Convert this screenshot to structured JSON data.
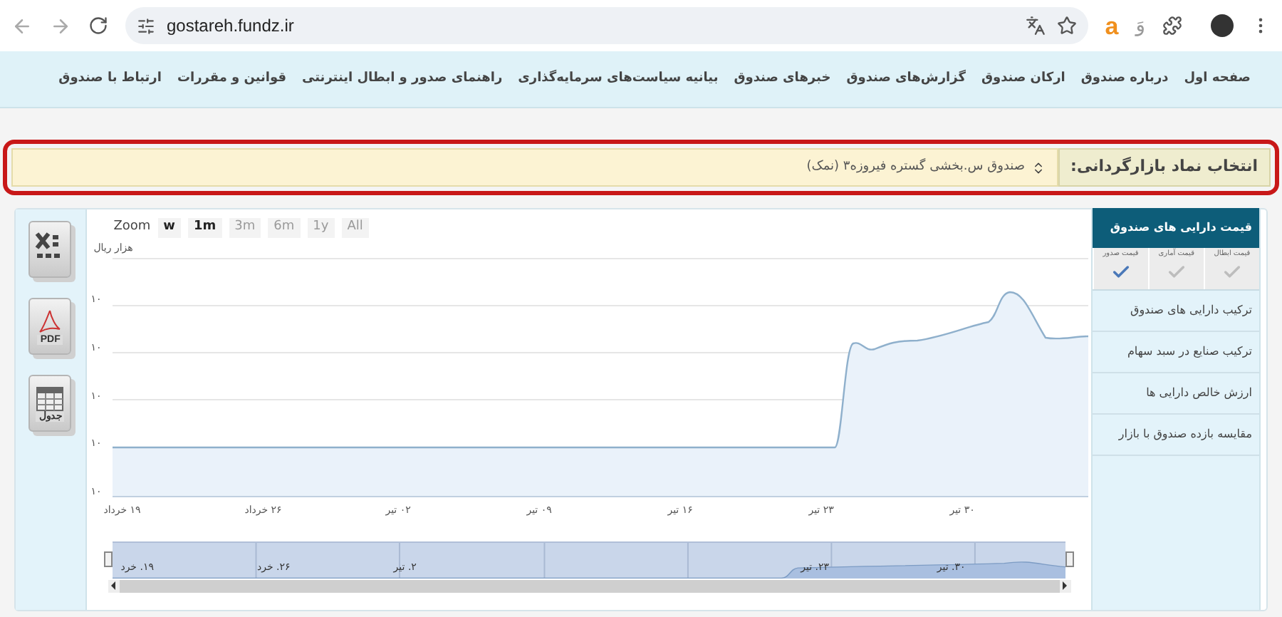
{
  "browser": {
    "url": "gostareh.fundz.ir",
    "extension_label": "a",
    "extension_label_2": "وَ"
  },
  "nav": {
    "items": [
      "صفحه اول",
      "درباره صندوق",
      "ارکان صندوق",
      "گزارش‌های صندوق",
      "خبرهای صندوق",
      "بیانیه سیاست‌های سرمایه‌گذاری",
      "راهنمای صدور و ابطال اینترنتی",
      "قوانین و مقررات",
      "ارتباط با صندوق"
    ]
  },
  "selector": {
    "label": "انتخاب نماد بازارگردانی:",
    "value": "صندوق س.بخشی گستره فیروزه۳ (نمک)"
  },
  "exports": [
    {
      "kind": "excel"
    },
    {
      "kind": "pdf",
      "label": "PDF"
    },
    {
      "kind": "table",
      "label": "جدول"
    }
  ],
  "chart": {
    "zoom_label": "Zoom",
    "zoom_buttons": [
      {
        "label": "All",
        "disabled": true
      },
      {
        "label": "1y",
        "disabled": true
      },
      {
        "label": "6m",
        "disabled": true
      },
      {
        "label": "3m",
        "disabled": true
      },
      {
        "label": "1m",
        "disabled": false
      },
      {
        "label": "w",
        "disabled": false
      }
    ],
    "ylabel": "هزار ریال",
    "yticks": [
      "۱۰",
      "۱۰",
      "۱۰",
      "۱۰",
      "۱۰"
    ],
    "xticks": [
      "۳۰ تیر",
      "۲۳ تیر",
      "۱۶ تیر",
      "۰۹ تیر",
      "۰۲ تیر",
      "۲۶ خرداد",
      "۱۹ خرداد"
    ],
    "navigator_labels": [
      "۳۰. تیر",
      "۲۳. تیر",
      "۲. تیر",
      "۲۶. خرد",
      "۱۹. خرد"
    ]
  },
  "sidebar": {
    "header": "قیمت دارایی های صندوق",
    "price_options": [
      {
        "label": "قیمت ابطال",
        "checked": false
      },
      {
        "label": "قیمت آماری",
        "checked": false
      },
      {
        "label": "قیمت صدور",
        "checked": true
      }
    ],
    "items": [
      "ترکیب دارایی های صندوق",
      "ترکیب صنایع در سبد سهام",
      "ارزش خالص دارایی ها",
      "مقایسه بازده صندوق با بازار"
    ]
  }
}
